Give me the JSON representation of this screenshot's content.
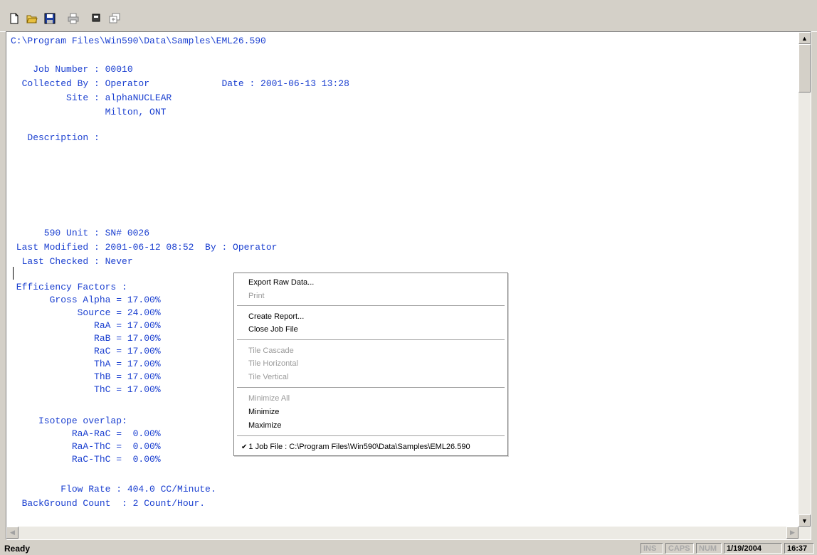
{
  "toolbar": {
    "buttons": [
      "new-icon",
      "open-icon",
      "save-icon",
      "print-icon",
      "cut-icon",
      "window-icon"
    ]
  },
  "document": {
    "path": "C:\\Program Files\\Win590\\Data\\Samples\\EML26.590",
    "lines": [
      "    Job Number : 00010",
      "  Collected By : Operator             Date : 2001-06-13 13:28",
      "          Site : alphaNUCLEAR",
      "                 Milton, ONT",
      "   Description :",
      "      590 Unit : SN# 0026",
      " Last Modified : 2001-06-12 08:52  By : Operator",
      "  Last Checked : Never",
      " Efficiency Factors :",
      "       Gross Alpha = 17.00%",
      "            Source = 24.00%",
      "               RaA = 17.00%",
      "               RaB = 17.00%",
      "               RaC = 17.00%",
      "               ThA = 17.00%",
      "               ThB = 17.00%",
      "               ThC = 17.00%",
      "     Isotope overlap:",
      "           RaA-RaC =  0.00%",
      "           RaA-ThC =  0.00%",
      "           RaC-ThC =  0.00%",
      "         Flow Rate : 404.0 CC/Minute.",
      "  BackGround Count  : 2 Count/Hour."
    ]
  },
  "menu": {
    "items": [
      {
        "label": "Export Raw Data...",
        "enabled": true
      },
      {
        "label": "Print",
        "enabled": false
      },
      {
        "label": "Create Report...",
        "enabled": true
      },
      {
        "label": "Close Job File",
        "enabled": true
      },
      {
        "label": "Tile Cascade",
        "enabled": false
      },
      {
        "label": "Tile Horizontal",
        "enabled": false
      },
      {
        "label": "Tile Vertical",
        "enabled": false
      },
      {
        "label": "Minimize All",
        "enabled": false
      },
      {
        "label": "Minimize",
        "enabled": true
      },
      {
        "label": "Maximize",
        "enabled": true
      },
      {
        "label": "1 Job File : C:\\Program Files\\Win590\\Data\\Samples\\EML26.590",
        "enabled": true,
        "checked": true
      }
    ]
  },
  "statusbar": {
    "text": "Ready",
    "ins": "INS",
    "caps": "CAPS",
    "num": "NUM",
    "date": "1/19/2004",
    "time": "16:37"
  }
}
